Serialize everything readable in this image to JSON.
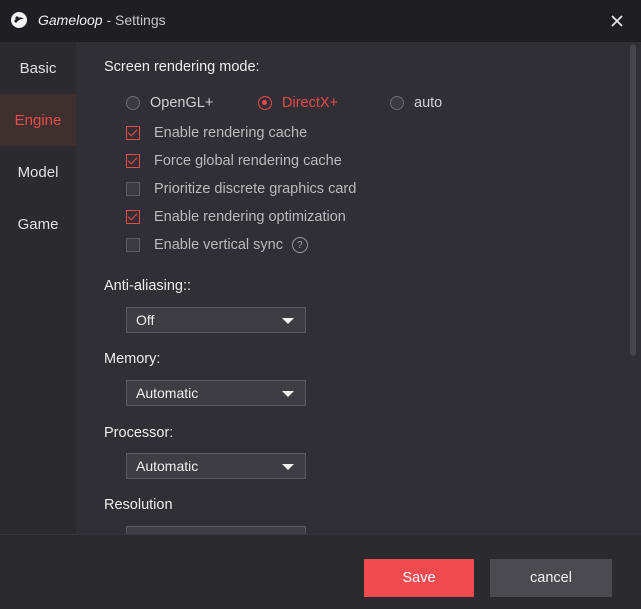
{
  "window": {
    "app_name": "Gameloop",
    "title_suffix": " - Settings"
  },
  "sidebar": {
    "items": [
      {
        "label": "Basic"
      },
      {
        "label": "Engine"
      },
      {
        "label": "Model"
      },
      {
        "label": "Game"
      }
    ],
    "active": "Engine"
  },
  "engine": {
    "render_mode": {
      "title": "Screen rendering mode:",
      "options": [
        "OpenGL+",
        "DirectX+",
        "auto"
      ],
      "selected": "DirectX+"
    },
    "checkboxes": [
      {
        "label": "Enable rendering cache",
        "checked": true
      },
      {
        "label": "Force global rendering cache",
        "checked": true
      },
      {
        "label": "Prioritize discrete graphics card",
        "checked": false
      },
      {
        "label": "Enable rendering optimization",
        "checked": true
      },
      {
        "label": "Enable vertical sync",
        "checked": false
      }
    ],
    "help_glyph": "?",
    "anti_aliasing": {
      "title": "Anti-aliasing::",
      "value": "Off"
    },
    "memory": {
      "title": "Memory:",
      "value": "Automatic"
    },
    "processor": {
      "title": "Processor:",
      "value": "Automatic"
    },
    "resolution": {
      "title": "Resolution"
    }
  },
  "footer": {
    "save_label": "Save",
    "cancel_label": "cancel"
  },
  "colors": {
    "accent": "#ee4a4a",
    "background": "#2f2f35",
    "titlebar": "#1f1f23"
  }
}
